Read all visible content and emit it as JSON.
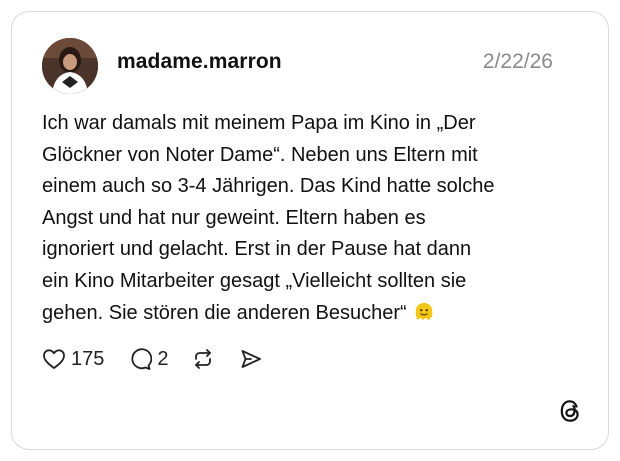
{
  "post": {
    "username": "madame.marron",
    "date": "2/22/26",
    "lines": [
      "Ich war damals mit meinem Papa im Kino in „Der",
      "Glöckner von Noter Dame“. Neben uns Eltern mit",
      "einem auch so 3-4 Jährigen. Das Kind hatte solche",
      "Angst und hat nur geweint. Eltern haben es",
      "ignoriert und gelacht. Erst in der Pause hat dann",
      "ein Kino Mitarbeiter gesagt „Vielleicht sollten sie",
      "gehen. Sie stören die anderen Besucher“"
    ],
    "trailing_emoji": "melting-face-emoji"
  },
  "actions": {
    "likes": "175",
    "replies": "2",
    "like_icon": "heart-icon",
    "reply_icon": "comment-bubble-icon",
    "repost_icon": "repost-icon",
    "share_icon": "send-icon"
  },
  "branding": {
    "logo": "threads-logo-icon"
  },
  "colors": {
    "text": "#111111",
    "muted": "#8a8a8a",
    "border": "#d9d9d9",
    "emoji": "#f5c518"
  }
}
